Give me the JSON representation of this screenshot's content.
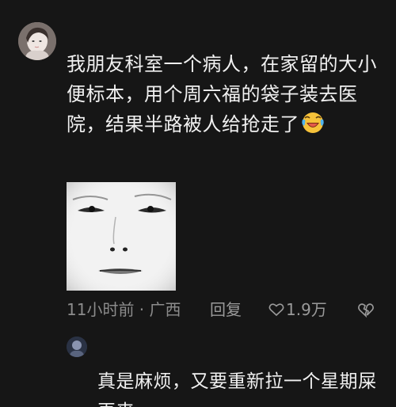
{
  "comment": {
    "text": "我朋友科室一个病人，在家留的大小便标本，用个周六福的袋子装去医院，结果半路被人给抢走了",
    "emoji_icon": "laughing-crying-emoji-icon",
    "sticker_icon": "meme-face-sticker",
    "meta": {
      "time_location": "11小时前 · 广西",
      "reply_label": "回复",
      "like_count": "1.9万"
    }
  },
  "reply": {
    "text": "真是麻烦，又要重新拉一个星期屎再来"
  },
  "colors": {
    "background": "#161616",
    "text_primary": "#f1f1f1",
    "text_secondary": "#8c8c8c"
  }
}
